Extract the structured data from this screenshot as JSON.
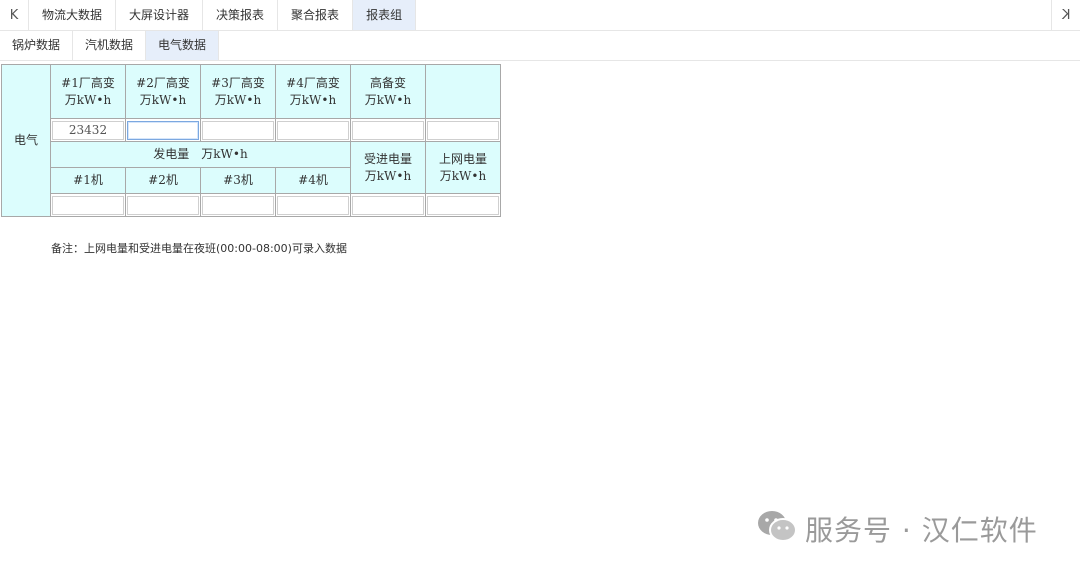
{
  "topbar": {
    "first_icon": "first-page-icon",
    "last_icon": "last-page-icon",
    "first_glyph": "K",
    "last_glyph": "K",
    "tabs": [
      "物流大数据",
      "大屏设计器",
      "决策报表",
      "聚合报表",
      "报表组"
    ],
    "active_tab": "报表组"
  },
  "subtabs": {
    "items": [
      "锅炉数据",
      "汽机数据",
      "电气数据"
    ],
    "active": "电气数据"
  },
  "report": {
    "row_label": "电气",
    "header_top": [
      {
        "line1": "#1厂高变",
        "line2": "万kW•h"
      },
      {
        "line1": "#2厂高变",
        "line2": "万kW•h"
      },
      {
        "line1": "#3厂高变",
        "line2": "万kW•h"
      },
      {
        "line1": "#4厂高变",
        "line2": "万kW•h"
      },
      {
        "line1": "高备变",
        "line2": "万kW•h"
      },
      {
        "line1": "",
        "line2": ""
      }
    ],
    "values_top": [
      "23432",
      "",
      "",
      "",
      "",
      ""
    ],
    "gen_label": "发电量　万kW•h",
    "recv": {
      "line1": "受进电量",
      "line2": "万kW•h"
    },
    "grid": {
      "line1": "上网电量",
      "line2": "万kW•h"
    },
    "units": [
      "#1机",
      "#2机",
      "#3机",
      "#4机"
    ],
    "values_bottom": [
      "",
      "",
      "",
      "",
      "",
      ""
    ]
  },
  "note": "备注：上网电量和受进电量在夜班(00:00-08:00)可录入数据",
  "watermark": {
    "text": "服务号 · 汉仁软件",
    "icon": "wechat-icon"
  }
}
